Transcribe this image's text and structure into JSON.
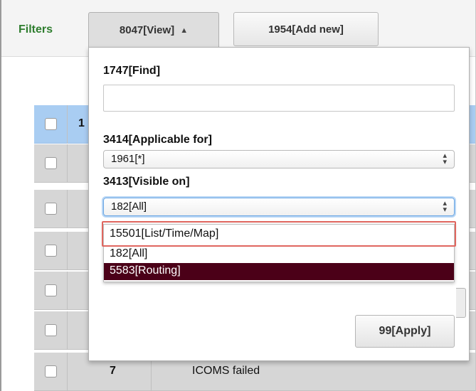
{
  "toolbar": {
    "filters_label": "Filters",
    "view_button": "8047[View]",
    "view_caret": "▲",
    "add_new_button": "1954[Add new]"
  },
  "panel": {
    "find_label": "1747[Find]",
    "find_value": "",
    "applicable_label": "3414[Applicable for]",
    "applicable_value": "1961[*]",
    "visible_label": "3413[Visible on]",
    "visible_value": "182[All]",
    "visible_options": [
      "15501[List/Time/Map]",
      "182[All]",
      "5583[Routing]"
    ],
    "apply_button": "99[Apply]"
  },
  "table": {
    "rows": [
      {
        "num": "1",
        "text": "",
        "selected": true
      },
      {
        "num": "",
        "text": "",
        "selected": false
      },
      {
        "num": "",
        "text": "",
        "selected": false
      },
      {
        "num": "",
        "text": "",
        "selected": false
      },
      {
        "num": "",
        "text": "",
        "selected": false
      },
      {
        "num": "",
        "text": "",
        "selected": false
      },
      {
        "num": "7",
        "text": "ICOMS failed",
        "selected": false
      }
    ]
  },
  "colors": {
    "filters_label": "#2e7d2e",
    "selected_row": "#a9cdf2",
    "highlight_option": "#4b0018",
    "annotation_box": "#e0665f",
    "focus_ring": "#6aa6e3"
  }
}
